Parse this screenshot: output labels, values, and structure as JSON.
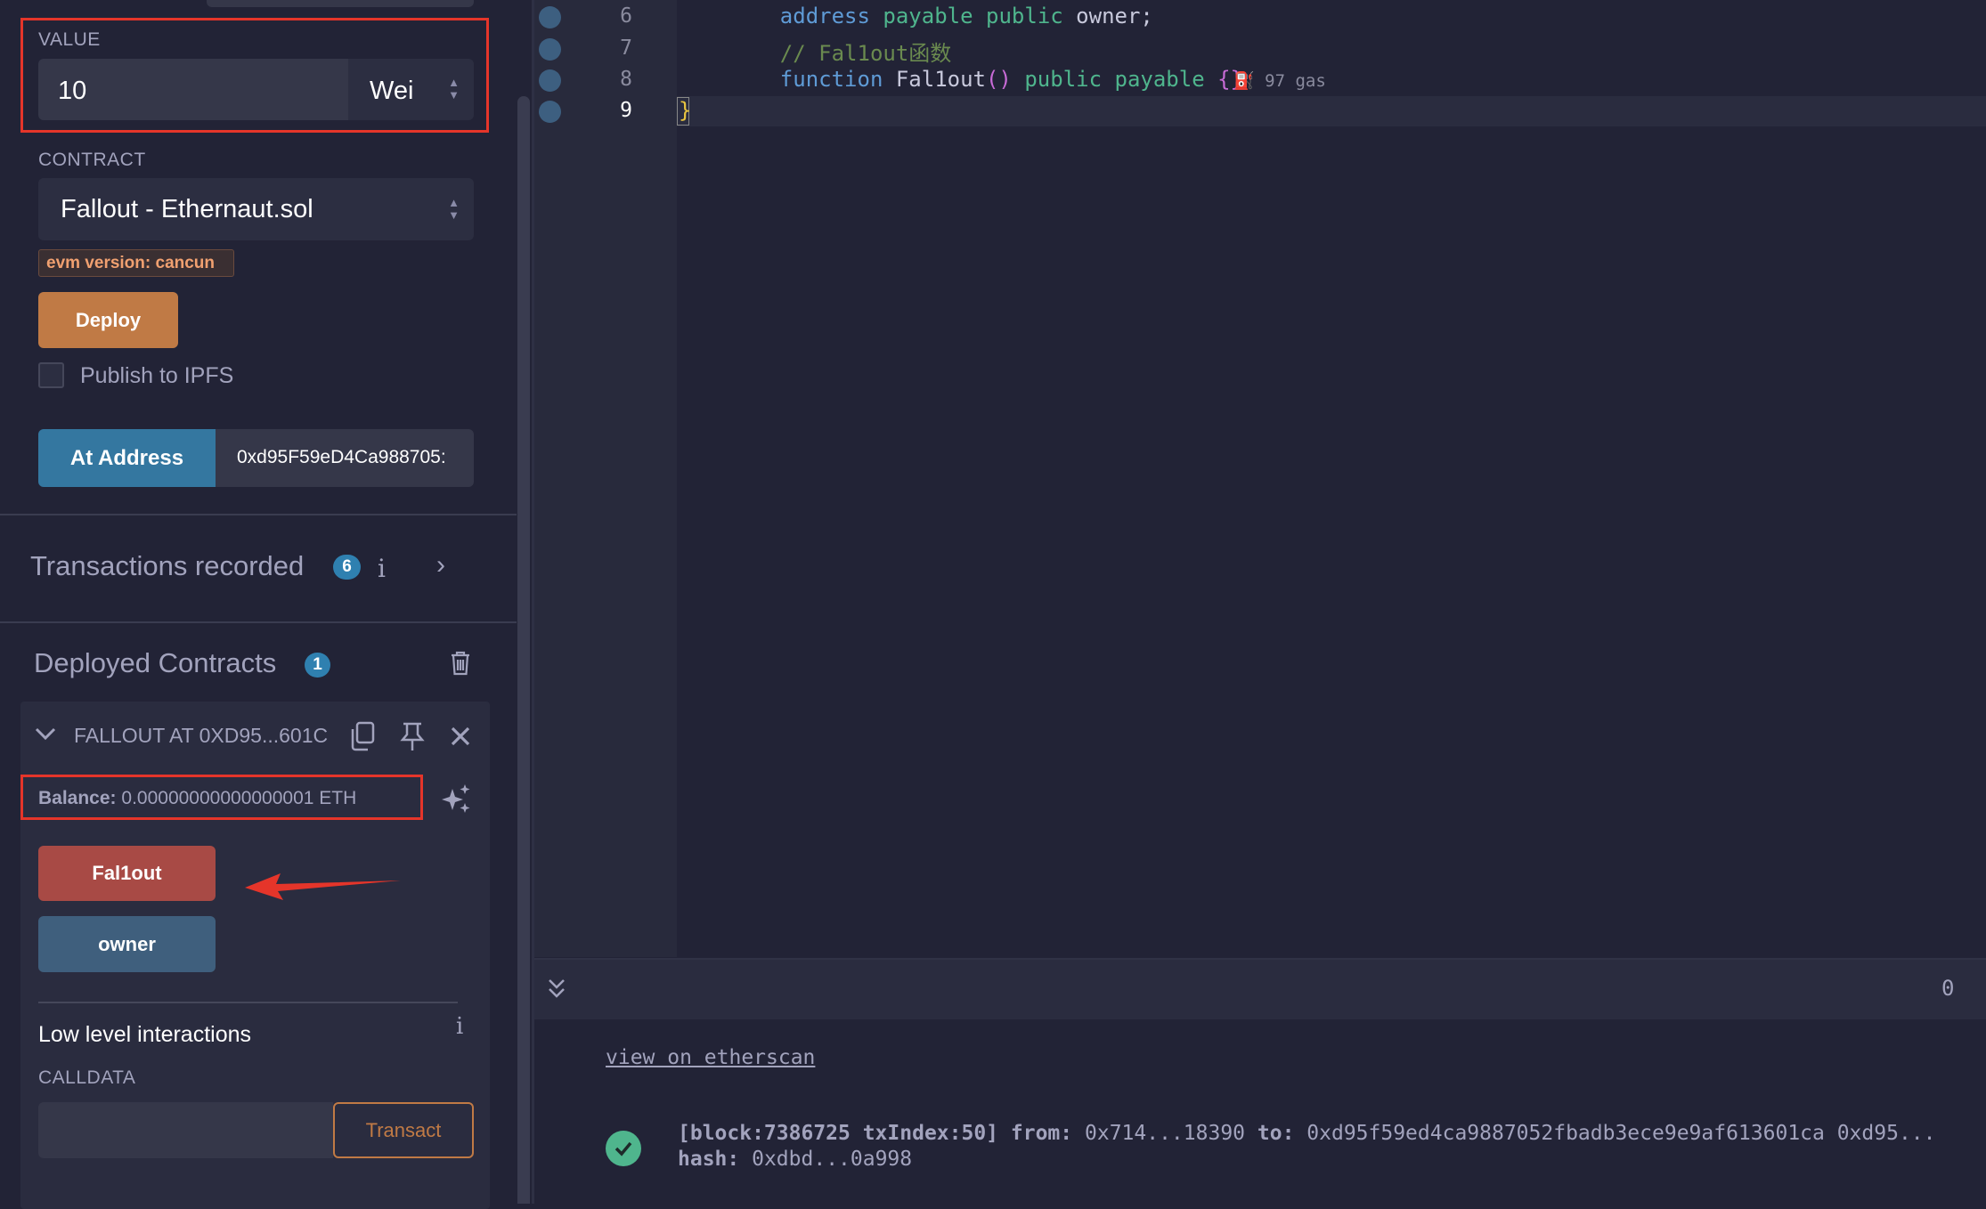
{
  "deploy_panel": {
    "value_label": "VALUE",
    "value_input": "10",
    "value_unit": "Wei",
    "contract_label": "CONTRACT",
    "contract_select": "Fallout - Ethernaut.sol",
    "evm_badge": "evm version: cancun",
    "deploy_button": "Deploy",
    "publish_ipfs_label": "Publish to IPFS",
    "publish_ipfs_checked": false,
    "at_address_button": "At Address",
    "at_address_input": "0xd95F59eD4Ca988705:"
  },
  "transactions": {
    "title": "Transactions recorded",
    "count": "6"
  },
  "deployed": {
    "title": "Deployed Contracts",
    "count": "1",
    "contract": {
      "name": "FALLOUT AT 0XD95...601C",
      "balance_label": "Balance:",
      "balance_value": "0.00000000000000001 ETH",
      "functions": [
        {
          "label": "Fal1out",
          "color": "#a84a45"
        },
        {
          "label": "owner",
          "color": "#3f5f7d"
        }
      ],
      "low_level_title": "Low level interactions",
      "calldata_label": "CALLDATA",
      "calldata_value": "",
      "transact_button": "Transact"
    }
  },
  "editor": {
    "lines": [
      {
        "num": "6",
        "tokens": [
          [
            "    ",
            "#c8c9dc"
          ],
          [
            "address",
            "#5f9bd6"
          ],
          [
            " ",
            "#c8c9dc"
          ],
          [
            "payable",
            "#4fb58d"
          ],
          [
            " ",
            "#c8c9dc"
          ],
          [
            "public",
            "#4fb58d"
          ],
          [
            " owner;",
            "#c8c9dc"
          ]
        ]
      },
      {
        "num": "7",
        "tokens": [
          [
            "    ",
            "#c8c9dc"
          ],
          [
            "// Fal1out函数",
            "#6a8a4f"
          ]
        ]
      },
      {
        "num": "8",
        "tokens": [
          [
            "    ",
            "#c8c9dc"
          ],
          [
            "function",
            "#5f9bd6"
          ],
          [
            " Fal1out",
            "#c8c9dc"
          ],
          [
            "()",
            "#c86bd6"
          ],
          [
            " ",
            "#c8c9dc"
          ],
          [
            "public",
            "#4fb58d"
          ],
          [
            " ",
            "#c8c9dc"
          ],
          [
            "payable",
            "#4fb58d"
          ],
          [
            " ",
            "#c8c9dc"
          ],
          [
            "{}",
            "#c86bd6"
          ]
        ],
        "gas": "97 gas"
      },
      {
        "num": "9",
        "tokens": [
          [
            "}",
            "#e8c440"
          ]
        ]
      }
    ]
  },
  "terminal": {
    "pending_count": "0",
    "etherscan_link": "view on etherscan",
    "tx_line": "[block:7386725 txIndex:50]",
    "from_label": "from:",
    "from_value": "0x714...18390",
    "to_label": "to:",
    "to_value": "0xd95f59ed4ca9887052fbadb3ece9e9af613601ca 0xd95...",
    "hash_label": "hash:",
    "hash_value": "0xdbd...0a998",
    "status": "success"
  },
  "colors": {
    "highlight": "#e5352a",
    "deploy": "#c07a45",
    "at_address": "#3477a0",
    "badge": "#2f80b0"
  }
}
